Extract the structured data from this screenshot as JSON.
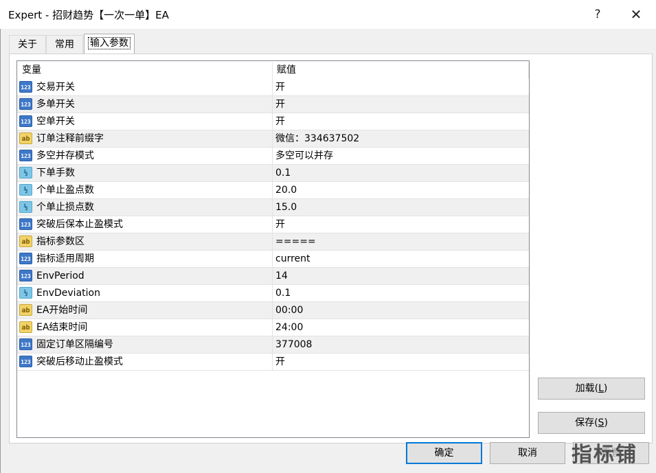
{
  "window": {
    "title": "Expert - 招财趋势【一次一单】EA",
    "help_glyph": "?",
    "close_glyph": "✕"
  },
  "tabs": [
    {
      "label": "关于"
    },
    {
      "label": "常用"
    },
    {
      "label": "输入参数"
    }
  ],
  "grid": {
    "col_variable": "变量",
    "col_value": "赋值",
    "rows": [
      {
        "icon": "int",
        "icon_text": "123",
        "name": "交易开关",
        "value": "开"
      },
      {
        "icon": "int",
        "icon_text": "123",
        "name": "多单开关",
        "value": "开"
      },
      {
        "icon": "int",
        "icon_text": "123",
        "name": "空单开关",
        "value": "开"
      },
      {
        "icon": "str",
        "icon_text": "ab",
        "name": "订单注释前缀字",
        "value": "微信：334637502"
      },
      {
        "icon": "int",
        "icon_text": "123",
        "name": "多空并存模式",
        "value": "多空可以并存"
      },
      {
        "icon": "dbl",
        "icon_text": "½",
        "name": "下单手数",
        "value": "0.1"
      },
      {
        "icon": "dbl",
        "icon_text": "½",
        "name": "个单止盈点数",
        "value": "20.0"
      },
      {
        "icon": "dbl",
        "icon_text": "½",
        "name": "个单止损点数",
        "value": "15.0"
      },
      {
        "icon": "int",
        "icon_text": "123",
        "name": "突破后保本止盈模式",
        "value": "开"
      },
      {
        "icon": "str",
        "icon_text": "ab",
        "name": "指标参数区",
        "value": "====="
      },
      {
        "icon": "int",
        "icon_text": "123",
        "name": "指标适用周期",
        "value": "current"
      },
      {
        "icon": "int",
        "icon_text": "123",
        "name": "EnvPeriod",
        "value": "14"
      },
      {
        "icon": "dbl",
        "icon_text": "½",
        "name": "EnvDeviation",
        "value": "0.1"
      },
      {
        "icon": "str",
        "icon_text": "ab",
        "name": "EA开始时间",
        "value": "00:00"
      },
      {
        "icon": "str",
        "icon_text": "ab",
        "name": "EA结束时间",
        "value": "24:00"
      },
      {
        "icon": "int",
        "icon_text": "123",
        "name": "固定订单区隔编号",
        "value": "377008"
      },
      {
        "icon": "int",
        "icon_text": "123",
        "name": "突破后移动止盈模式",
        "value": "开"
      }
    ]
  },
  "buttons": {
    "load_label": "加载(",
    "load_key": "L",
    "load_tail": ")",
    "save_label": "保存(",
    "save_key": "S",
    "save_tail": ")",
    "ok_label": "确定",
    "cancel_label": "取消",
    "reset_label": "重置"
  },
  "watermark": {
    "text": "指标铺"
  }
}
